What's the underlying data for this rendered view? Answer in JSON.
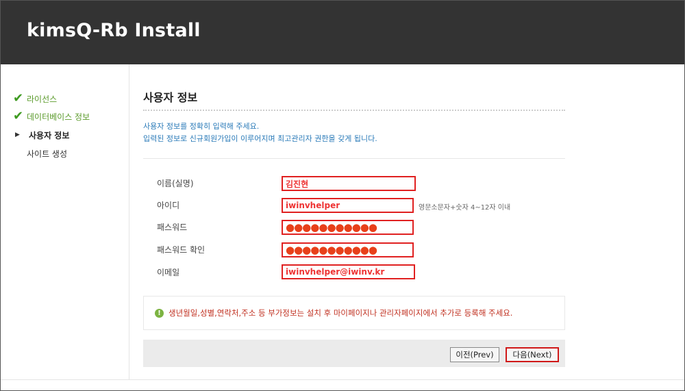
{
  "header": {
    "title": "kimsQ-Rb Install"
  },
  "steps": [
    {
      "label": "라이선스",
      "status": "done"
    },
    {
      "label": "데이터베이스 정보",
      "status": "done"
    },
    {
      "label": "사용자 정보",
      "status": "current"
    },
    {
      "label": "사이트 생성",
      "status": "todo"
    }
  ],
  "main": {
    "title": "사용자 정보",
    "desc_line1": "사용자 정보를 정확히 입력해 주세요.",
    "desc_line2": "입력된 정보로 신규회원가입이 이루어지며 최고관리자 권한을 갖게 됩니다."
  },
  "form": {
    "name": {
      "label": "이름(실명)",
      "value": "김진현"
    },
    "id": {
      "label": "아이디",
      "value": "iwinvhelper",
      "hint": "영문소문자+숫자 4~12자 이내"
    },
    "password": {
      "label": "패스워드",
      "value": "●●●●●●●●●●●"
    },
    "password_confirm": {
      "label": "패스워드 확인",
      "value": "●●●●●●●●●●●"
    },
    "email": {
      "label": "이메일",
      "value": "iwinvhelper@iwinv.kr"
    }
  },
  "notice": {
    "icon": "exclamation-icon",
    "text": "생년월일,성별,연락처,주소 등 부가정보는 설치 후 마이페이지나 관리자페이지에서 추가로 등록해 주세요."
  },
  "buttons": {
    "prev": "이전(Prev)",
    "next": "다음(Next)"
  },
  "colors": {
    "header_bg": "#333333",
    "done": "#5a9a2a",
    "highlight": "#e02020",
    "desc": "#2a7ab8"
  }
}
